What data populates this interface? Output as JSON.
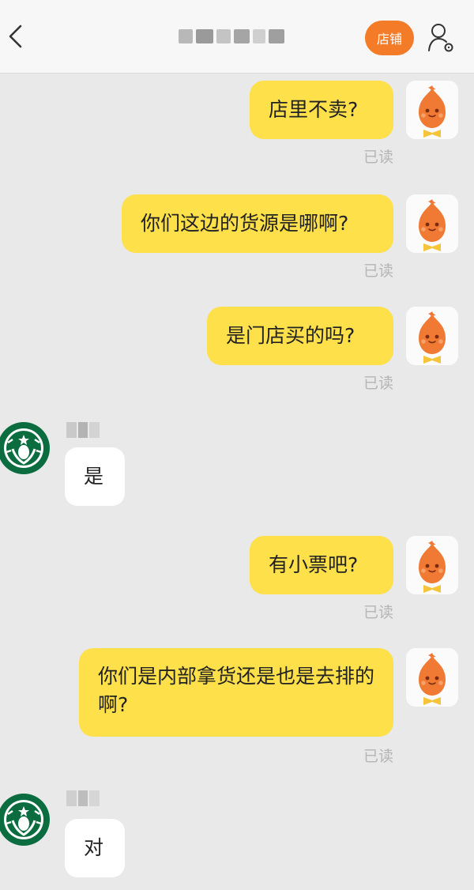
{
  "header": {
    "shop_label": "店铺",
    "back_icon": "chevron-left-icon",
    "user_icon": "user-settings-icon",
    "accent": "#f47c28"
  },
  "messages": [
    {
      "side": "right",
      "text": "店里不卖?",
      "status": "已读"
    },
    {
      "side": "right",
      "text": "你们这边的货源是哪啊?",
      "status": "已读"
    },
    {
      "side": "right",
      "text": "是门店买的吗?",
      "status": "已读"
    },
    {
      "side": "left",
      "text": "是"
    },
    {
      "side": "right",
      "text": "有小票吧?",
      "status": "已读"
    },
    {
      "side": "right",
      "text": "你们是内部拿货还是也是去排的啊?",
      "status": "已读"
    },
    {
      "side": "left",
      "text": "对"
    }
  ],
  "colors": {
    "self_bubble": "#fde04a",
    "other_bubble": "#ffffff",
    "background": "#e9e9e9"
  }
}
